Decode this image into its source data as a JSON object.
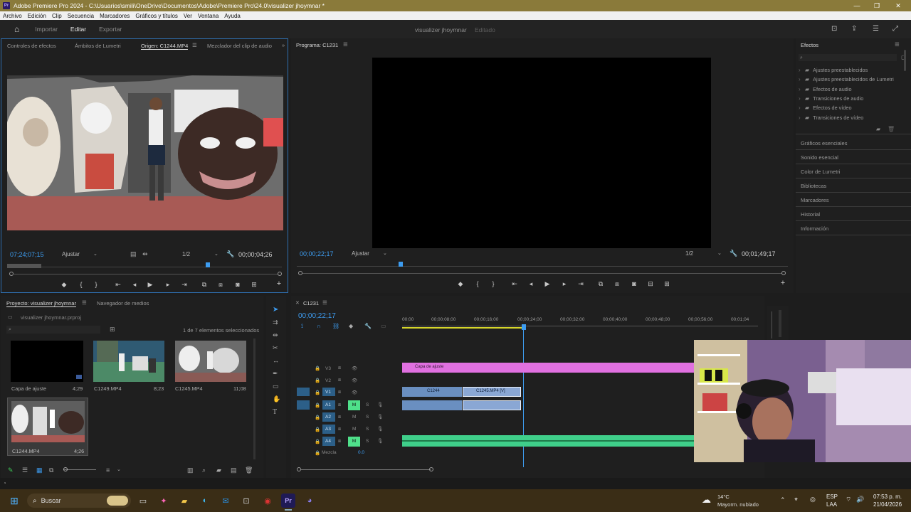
{
  "titlebar": {
    "title": "Adobe Premiere Pro 2024 - C:\\Usuarios\\smili\\OneDrive\\Documentos\\Adobe\\Premiere Pro\\24.0\\visualizer jhoymnar *",
    "app_badge": "Pr"
  },
  "menu": [
    "Archivo",
    "Edición",
    "Clip",
    "Secuencia",
    "Marcadores",
    "Gráficos y títulos",
    "Ver",
    "Ventana",
    "Ayuda"
  ],
  "header": {
    "tabs": [
      "Importar",
      "Editar",
      "Exportar"
    ],
    "active_tab": "Editar",
    "project_title": "visualizer jhoymnar",
    "project_status": "Editado"
  },
  "source_panel": {
    "tabs": [
      "Controles de efectos",
      "Ámbitos de Lumetri",
      "Origen: C1244.MP4",
      "Mezclador del clip de audio"
    ],
    "timecode_in": "07;24;07;15",
    "fit": "Ajustar",
    "resolution": "1/2",
    "duration": "00;00;04;26"
  },
  "program_panel": {
    "title": "Programa: C1231",
    "timecode": "00;00;22;17",
    "fit": "Ajustar",
    "resolution": "1/2",
    "duration": "00;01;49;17"
  },
  "effects_panel": {
    "title": "Efectos",
    "folders": [
      "Ajustes preestablecidos",
      "Ajustes preestablecidos de Lumetri",
      "Efectos de audio",
      "Transiciones de audio",
      "Efectos de vídeo",
      "Transiciones de vídeo"
    ],
    "sections": [
      "Gráficos esenciales",
      "Sonido esencial",
      "Color de Lumetri",
      "Bibliotecas",
      "Marcadores",
      "Historial",
      "Información"
    ]
  },
  "project_panel": {
    "tabs": [
      "Proyecto: visualizer jhoymnar",
      "Navegador de medios"
    ],
    "file": "visualizer jhoymnar.prproj",
    "selection": "1 de 7 elementos seleccionados",
    "items": [
      {
        "name": "Capa de ajuste",
        "duration": "4;29"
      },
      {
        "name": "C1249.MP4",
        "duration": "8;23"
      },
      {
        "name": "C1245.MP4",
        "duration": "11;08"
      },
      {
        "name": "C1244.MP4",
        "duration": "4;26"
      }
    ]
  },
  "timeline": {
    "sequence": "C1231",
    "timecode": "00;00;22;17",
    "ruler": [
      "00;00",
      "00;00;08;00",
      "00;00;16;00",
      "00;00;24;00",
      "00;00;32;00",
      "00;00;40;00",
      "00;00;48;00",
      "00;00;56;00",
      "00;01;04"
    ],
    "tracks": [
      "V3",
      "V2",
      "V1",
      "A1",
      "A2",
      "A3",
      "A4"
    ],
    "mix_label": "Mezcla",
    "mix_value": "0.0",
    "clips": {
      "adjust": "Capa de ajuste",
      "c1244": "C1244",
      "c1245": "C1245.MP4 [V]"
    }
  },
  "taskbar": {
    "search": "Buscar",
    "weather_temp": "14°C",
    "weather_desc": "Mayorm. nublado",
    "lang1": "ESP",
    "lang2": "LAA",
    "time": "07:53 p. m.",
    "date": "21/04/2026"
  },
  "colors": {
    "accent_blue": "#3d9cf0",
    "adjust_clip": "#e070e0",
    "video_clip": "#6a8fc0",
    "audio_clip": "#3fcf8a",
    "taskbar": "#3a2d16"
  }
}
